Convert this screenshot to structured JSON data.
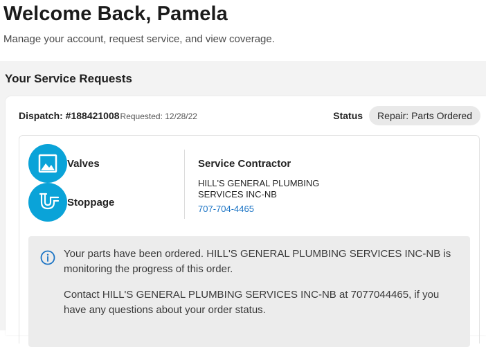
{
  "header": {
    "title": "Welcome Back, Pamela",
    "subtitle": "Manage your account, request service, and view coverage."
  },
  "requests": {
    "section_title": "Your Service Requests",
    "card": {
      "dispatch_label": "Dispatch: #188421008",
      "requested": "Requested: 12/28/22",
      "status_label": "Status",
      "status_value": "Repair: Parts Ordered",
      "items": [
        {
          "label": "Valves",
          "icon": "image-icon"
        },
        {
          "label": "Stoppage",
          "icon": "pipe-icon"
        }
      ],
      "contractor": {
        "heading": "Service Contractor",
        "name": "HILL'S GENERAL PLUMBING SERVICES INC-NB",
        "phone": "707-704-4465"
      },
      "info": {
        "paragraph1": "Your parts have been ordered. HILL'S GENERAL PLUMBING SERVICES INC-NB is monitoring the progress of this order.",
        "paragraph2": "Contact HILL'S GENERAL PLUMBING SERVICES INC-NB at 7077044465, if you have any questions about your order status."
      }
    }
  },
  "colors": {
    "accent": "#0aa3d8",
    "link": "#1a73c4",
    "info_icon": "#1a73c4"
  }
}
